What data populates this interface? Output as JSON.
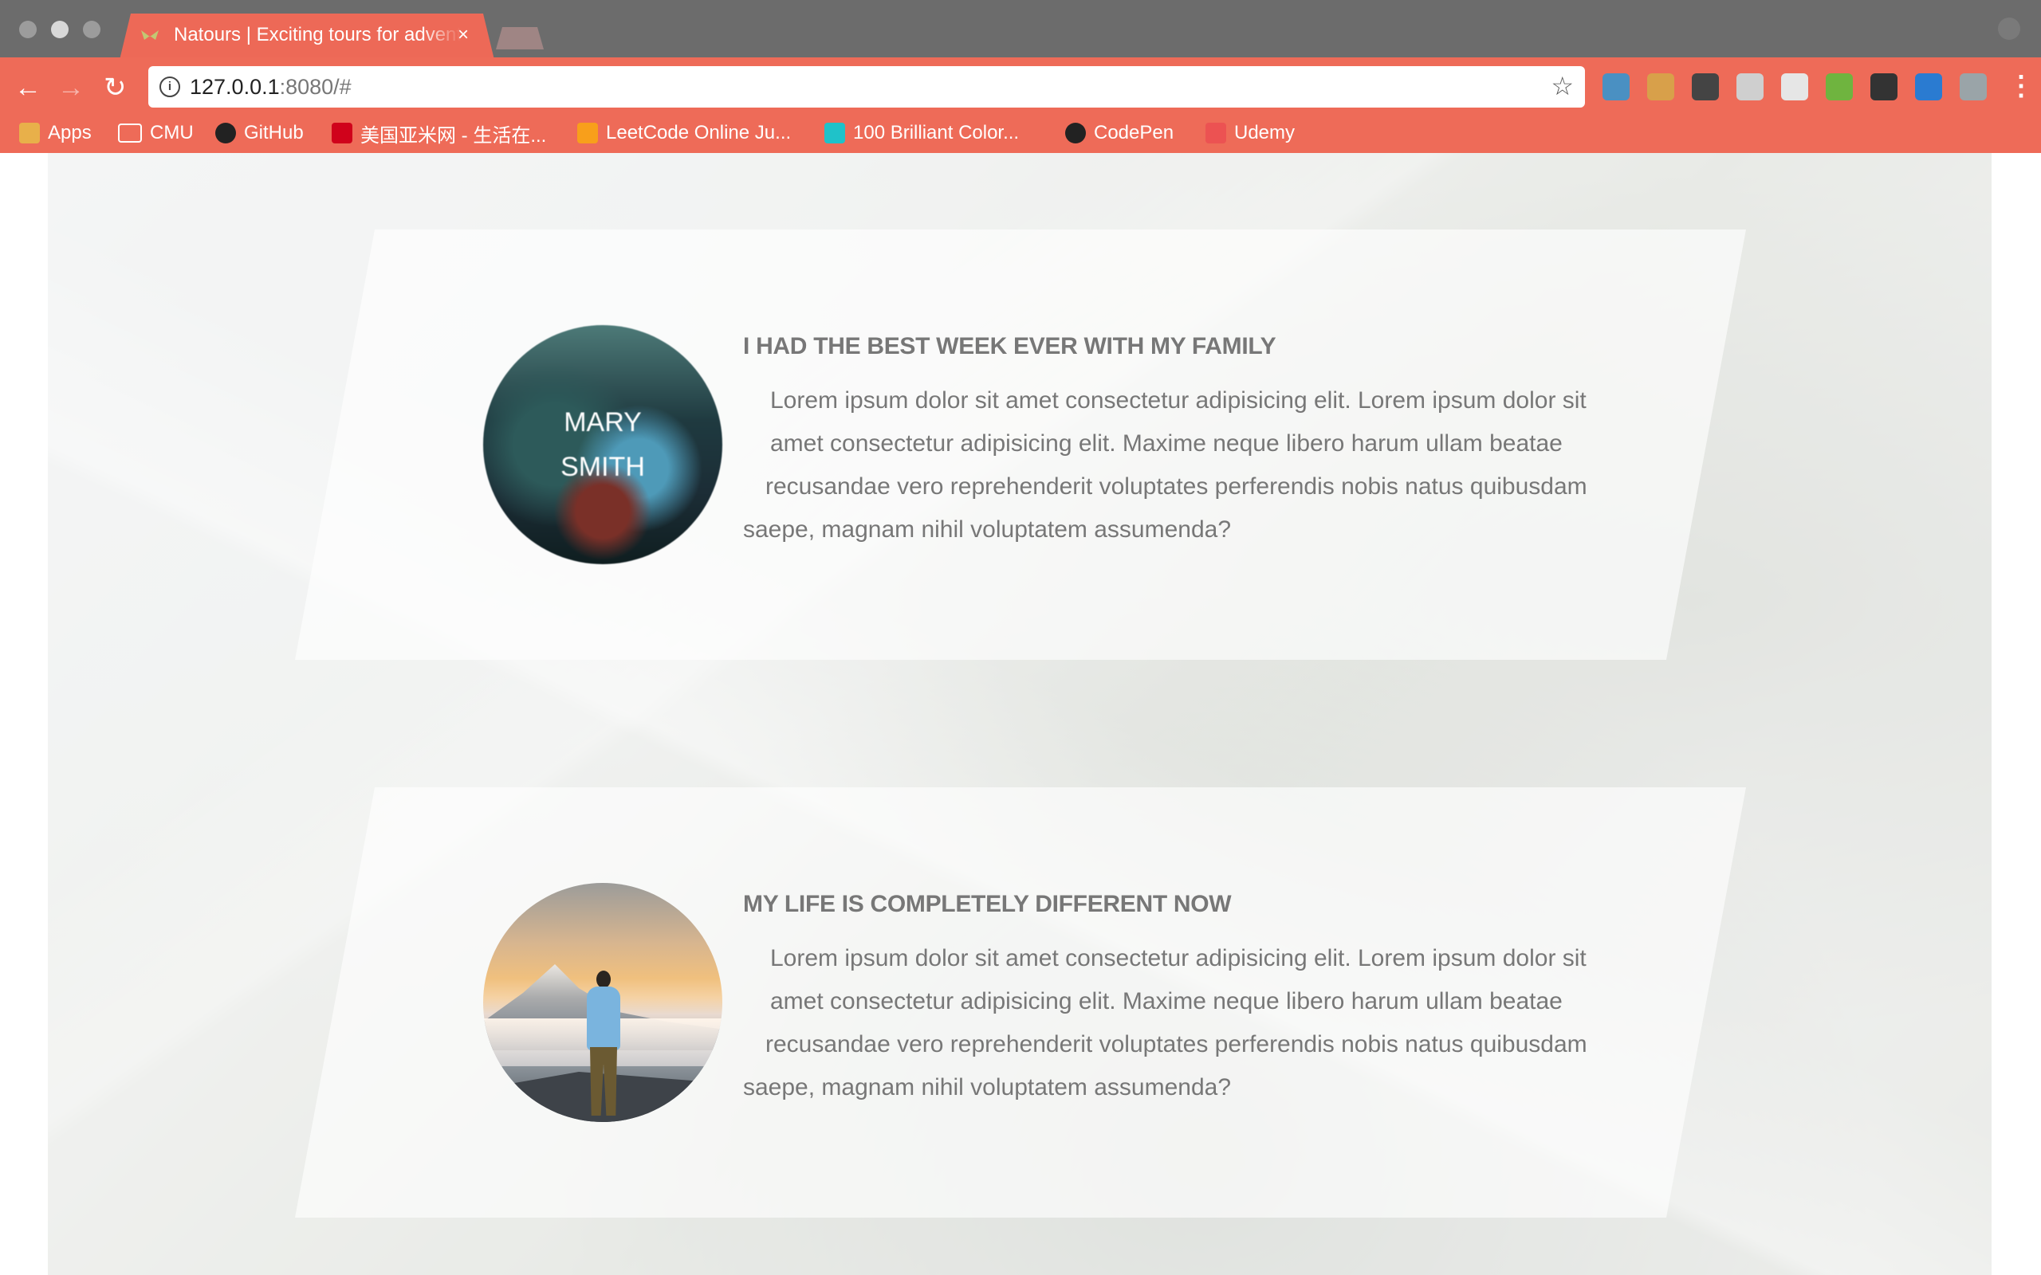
{
  "browser": {
    "tab_title": "Natours | Exciting tours for adventurous people",
    "tab_close": "×",
    "url_host": "127.0.0.1",
    "url_rest": ":8080/#",
    "info_glyph": "i",
    "star_glyph": "☆",
    "back_glyph": "←",
    "forward_glyph": "→",
    "reload_glyph": "↻",
    "menu_glyph": "⋮",
    "bookmarks": [
      {
        "label": "Apps",
        "icon": "apps-icon",
        "color": "#e8b04a"
      },
      {
        "label": "CMU",
        "icon": "folder-icon",
        "color": "#ffffff"
      },
      {
        "label": "GitHub",
        "icon": "github-icon",
        "color": "#222222"
      },
      {
        "label": "美国亚米网 - 生活在...",
        "icon": "yamibuy-icon",
        "color": "#d0021b"
      },
      {
        "label": "LeetCode Online Ju...",
        "icon": "leetcode-icon",
        "color": "#f89f1b"
      },
      {
        "label": "100 Brilliant Color...",
        "icon": "canva-icon",
        "color": "#1fc2c9"
      },
      {
        "label": "CodePen",
        "icon": "codepen-icon",
        "color": "#222222"
      },
      {
        "label": "Udemy",
        "icon": "udemy-icon",
        "color": "#ec5252"
      }
    ],
    "extensions": [
      {
        "icon": "shield-extension-icon",
        "color": "#4a90c2"
      },
      {
        "icon": "cookie-extension-icon",
        "color": "#d8a04a"
      },
      {
        "icon": "eyedropper-extension-icon",
        "color": "#444444"
      },
      {
        "icon": "jb-extension-icon",
        "color": "#cfcfcf"
      },
      {
        "icon": "b-extension-icon",
        "color": "#e6e6e6"
      },
      {
        "icon": "download-extension-icon",
        "color": "#6fb43f"
      },
      {
        "icon": "notification-extension-icon",
        "color": "#333333"
      },
      {
        "icon": "pocket-extension-icon",
        "color": "#2a7bd1"
      },
      {
        "icon": "vue-extension-icon",
        "color": "#9aa4a8"
      }
    ]
  },
  "stories": [
    {
      "avatar_caption_line1": "Mary",
      "avatar_caption_line2": "Smith",
      "title": "I had the best week ever with my family",
      "text_lines": [
        "Lorem ipsum dolor sit amet consectetur adipisicing elit. Lorem ipsum dolor sit",
        "amet consectetur adipisicing elit. Maxime neque libero harum ullam beatae",
        "recusandae vero reprehenderit voluptates perferendis nobis natus quibusdam",
        "saepe, magnam nihil voluptatem assumenda?"
      ]
    },
    {
      "title": "My life is completely different now",
      "text_lines": [
        "Lorem ipsum dolor sit amet consectetur adipisicing elit. Lorem ipsum dolor sit",
        "amet consectetur adipisicing elit. Maxime neque libero harum ullam beatae",
        "recusandae vero reprehenderit voluptates perferendis nobis natus quibusdam",
        "saepe, magnam nihil voluptatem assumenda?"
      ]
    }
  ]
}
